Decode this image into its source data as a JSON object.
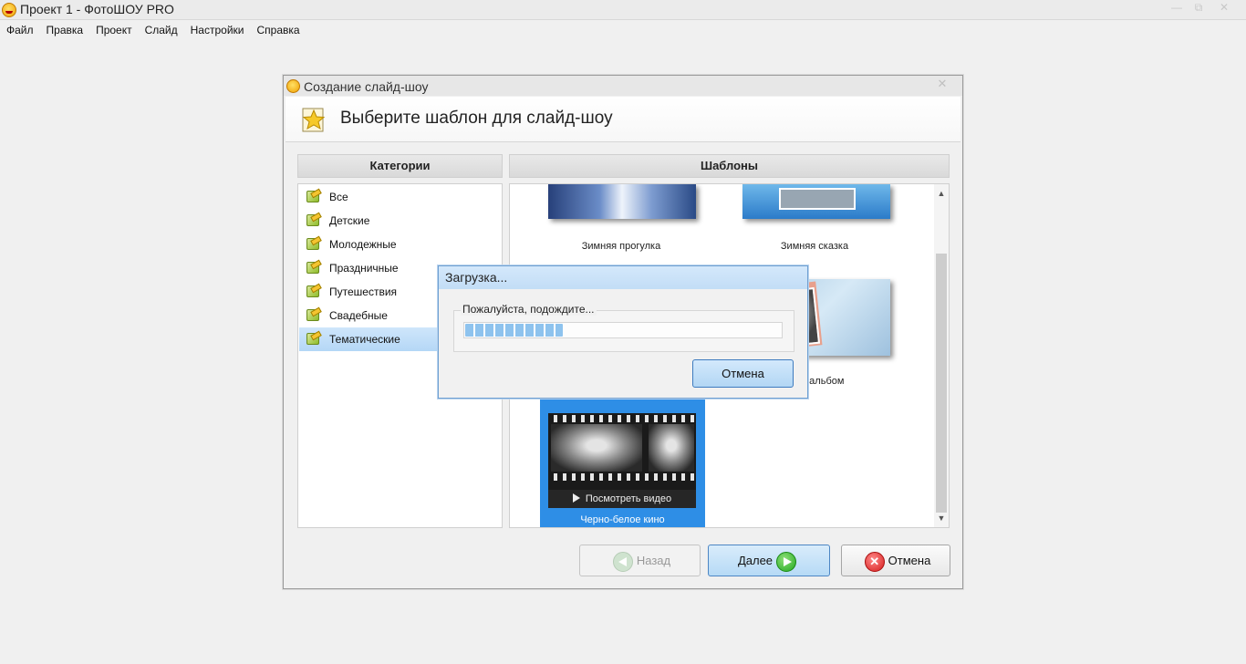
{
  "app": {
    "title": "Проект 1 - ФотоШОУ PRO",
    "window_controls": {
      "minimize": "—",
      "maximize": "⧉",
      "close": "✕"
    }
  },
  "menu": [
    "Файл",
    "Правка",
    "Проект",
    "Слайд",
    "Настройки",
    "Справка"
  ],
  "wizard": {
    "title": "Создание слайд-шоу",
    "close": "✕",
    "header": "Выберите шаблон для слайд-шоу",
    "categories_header": "Категории",
    "templates_header": "Шаблоны",
    "categories": [
      "Все",
      "Детские",
      "Молодежные",
      "Праздничные",
      "Путешествия",
      "Свадебные",
      "Тематические"
    ],
    "selected_category": "Тематические",
    "templates": [
      {
        "label": "Зимняя прогулка"
      },
      {
        "label": "Зимняя сказка"
      },
      {
        "label": "ный альбом"
      },
      {
        "label": "Черно-белое кино",
        "selected": true,
        "overlay": "Посмотреть видео"
      }
    ],
    "buttons": {
      "back": "Назад",
      "next": "Далее",
      "cancel": "Отмена"
    },
    "scroll": {
      "up": "▲",
      "down": "▼"
    }
  },
  "loading_dialog": {
    "title": "Загрузка...",
    "message": "Пожалуйста, подождите...",
    "progress": 0.31,
    "cancel": "Отмена"
  },
  "colors": {
    "accent": "#2e8ee6",
    "selection": "#b4d7f6",
    "progress": "#8ec3ee"
  }
}
